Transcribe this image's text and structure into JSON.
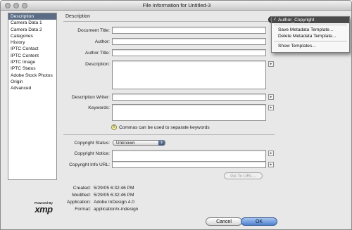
{
  "window": {
    "title": "File Information for Untitled-3"
  },
  "sidebar": {
    "items": [
      {
        "label": "Description",
        "selected": true
      },
      {
        "label": "Camera Data 1",
        "selected": false
      },
      {
        "label": "Camera Data 2",
        "selected": false
      },
      {
        "label": "Categories",
        "selected": false
      },
      {
        "label": "History",
        "selected": false
      },
      {
        "label": "IPTC Contact",
        "selected": false
      },
      {
        "label": "IPTC Content",
        "selected": false
      },
      {
        "label": "IPTC Image",
        "selected": false
      },
      {
        "label": "IPTC Status",
        "selected": false
      },
      {
        "label": "Adobe Stock Photos",
        "selected": false
      },
      {
        "label": "Origin",
        "selected": false
      },
      {
        "label": "Advanced",
        "selected": false
      }
    ]
  },
  "section": {
    "title": "Description"
  },
  "fields": {
    "document_title": {
      "label": "Document Title:",
      "value": ""
    },
    "author": {
      "label": "Author:",
      "value": ""
    },
    "author_title": {
      "label": "Author Title:",
      "value": ""
    },
    "description": {
      "label": "Description:",
      "value": ""
    },
    "description_writer": {
      "label": "Description Writer:",
      "value": ""
    },
    "keywords": {
      "label": "Keywords:",
      "value": ""
    },
    "keywords_hint": "Commas can be used to separate keywords",
    "copyright_status": {
      "label": "Copyright Status:",
      "value": "Unknown"
    },
    "copyright_notice": {
      "label": "Copyright Notice:",
      "value": ""
    },
    "copyright_info_url": {
      "label": "Copyright Info URL:",
      "value": ""
    },
    "goto_url_button": "Go To URL..."
  },
  "metadata": {
    "created": {
      "label": "Created:",
      "value": "5/29/05 6:32:46 PM"
    },
    "modified": {
      "label": "Modified:",
      "value": "5/29/05 6:32:46 PM"
    },
    "application": {
      "label": "Application:",
      "value": "Adobe InDesign 4.0"
    },
    "format": {
      "label": "Format:",
      "value": "application/x-indesign"
    }
  },
  "logo": {
    "powered": "Powered By",
    "word": "xmp"
  },
  "buttons": {
    "cancel": "Cancel",
    "ok": "OK"
  },
  "menu": {
    "items": [
      {
        "label": "Author_Copyright",
        "checked": true
      },
      {
        "label": "Save Metadata Template...",
        "checked": false
      },
      {
        "label": "Delete Metadata Template...",
        "checked": false
      },
      {
        "label": "Show Templates...",
        "checked": false
      }
    ]
  },
  "icons": {
    "menu_check": "✓",
    "field_arrow": "▸",
    "hint": "!",
    "select_caret": "⇕",
    "dropdown": "▸"
  },
  "colors": {
    "selection": "#5a6c86",
    "default_button": "#4f82cf",
    "menu_highlight": "#4a4a4a"
  }
}
